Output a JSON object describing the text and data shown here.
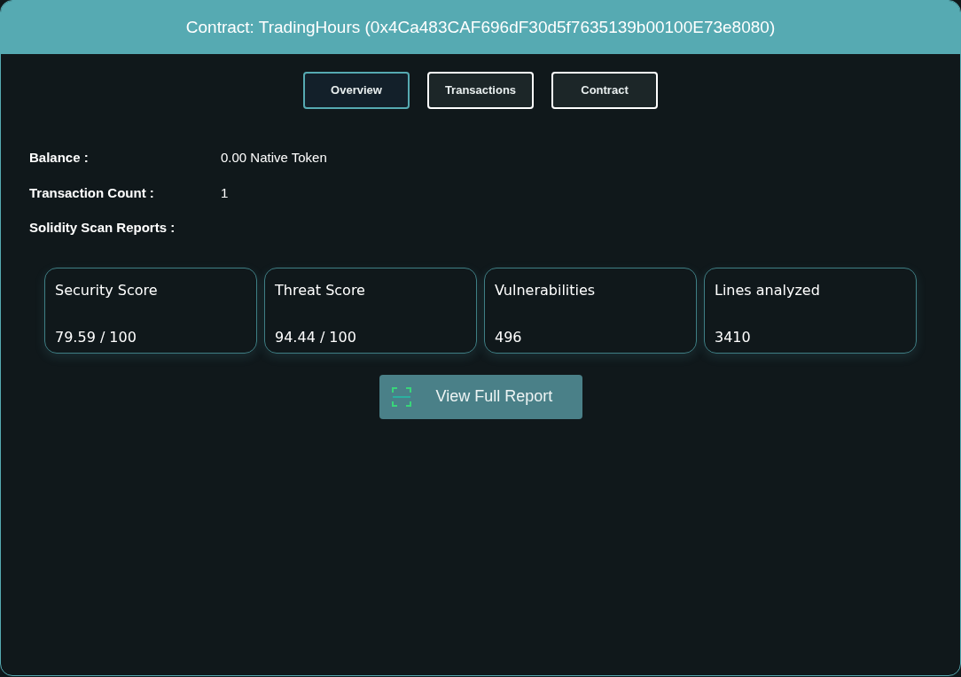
{
  "window": {
    "title": "Contract: TradingHours (0x4Ca483CAF696dF30d5f7635139b00100E73e8080)"
  },
  "tabs": [
    {
      "label": "Overview",
      "selected": true
    },
    {
      "label": "Transactions",
      "selected": false
    },
    {
      "label": "Contract",
      "selected": false
    }
  ],
  "details": [
    {
      "label": "Balance :",
      "value": "0.00 Native Token"
    },
    {
      "label": "Transaction Count :",
      "value": "1"
    },
    {
      "label": "Solidity Scan Reports :"
    }
  ],
  "score_cards": [
    {
      "title": "Security Score",
      "value": "79.59 / 100"
    },
    {
      "title": "Threat Score",
      "value": "94.44 / 100"
    },
    {
      "title": "Vulnerabilities",
      "value": "496"
    },
    {
      "title": "Lines analyzed",
      "value": "3410"
    }
  ],
  "report_button": {
    "label": "View Full Report"
  }
}
